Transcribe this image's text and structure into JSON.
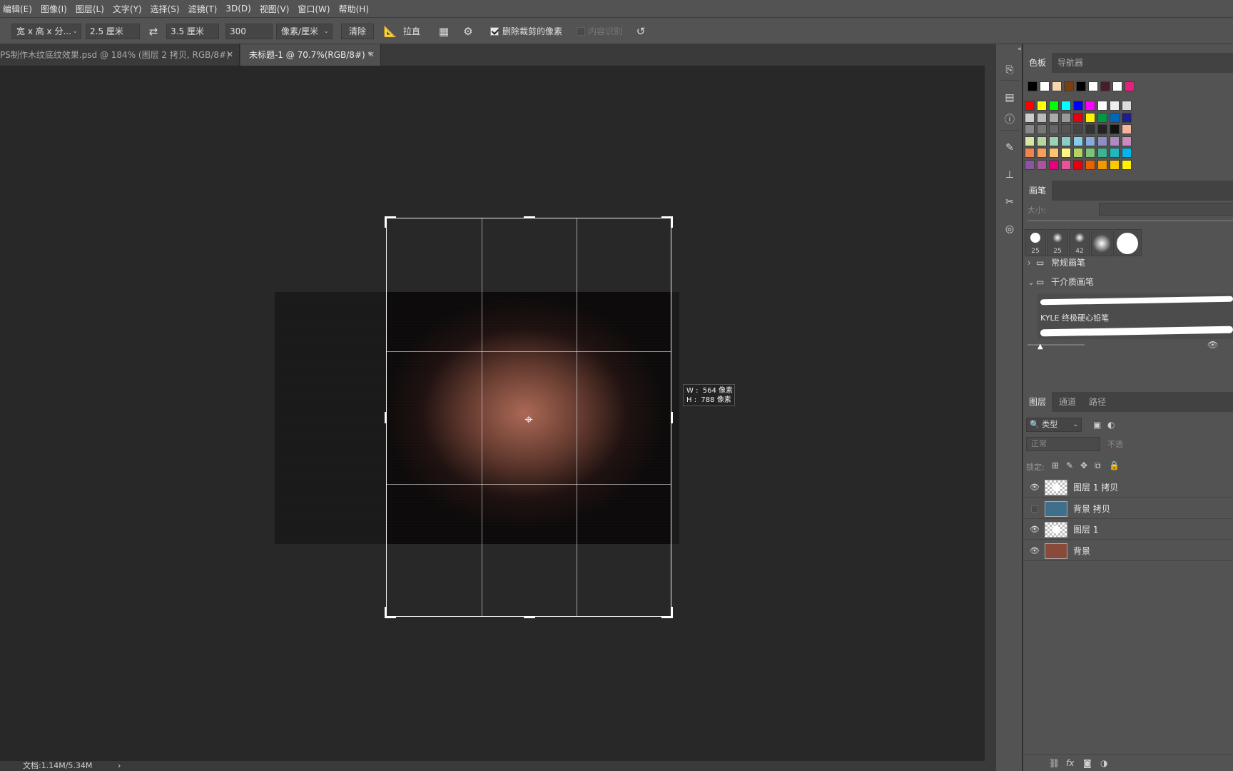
{
  "menu": [
    "编辑(E)",
    "图像(I)",
    "图层(L)",
    "文字(Y)",
    "选择(S)",
    "滤镜(T)",
    "3D(D)",
    "视图(V)",
    "窗口(W)",
    "帮助(H)"
  ],
  "options_bar": {
    "ratio_preset": "宽 x 高 x 分...",
    "width_value": "2.5 厘米",
    "height_value": "3.5 厘米",
    "resolution_value": "300",
    "resolution_unit": "像素/厘米",
    "clear_label": "清除",
    "straighten_label": "拉直",
    "delete_cropped_label": "删除裁剪的像素",
    "delete_cropped_checked": true,
    "content_aware_label": "内容识别",
    "content_aware_checked": false
  },
  "tabs": [
    {
      "label": "PS制作木纹底纹效果.psd @ 184% (图层 2 拷贝, RGB/8#)",
      "active": false
    },
    {
      "label": "未标题-1 @ 70.7%(RGB/8#) *",
      "active": true
    }
  ],
  "crop_tooltip": {
    "w_label": "W :  564 像素",
    "h_label": "H :  788 像素"
  },
  "status_bar": {
    "doc_info": "文档:1.14M/5.34M",
    "arrow": "›"
  },
  "swatches_panel": {
    "tabs": [
      "色板",
      "导航器"
    ],
    "recent_colors": [
      "#000000",
      "#ffffff",
      "#f6d6b0",
      "#7a3e14",
      "#000000",
      "#ffffff",
      "#4a1a2e",
      "#ffffff",
      "#e6207d"
    ],
    "grid_colors": [
      [
        "#ff0000",
        "#ffff00",
        "#00ff00",
        "#00ffff",
        "#0000ff",
        "#ff00ff",
        "#ffffff",
        "#eeeeee",
        "#dddddd"
      ],
      [
        "#cccccc",
        "#bbbbbb",
        "#aaaaaa",
        "#999999",
        "#e60012",
        "#fff100",
        "#009944",
        "#0068b7",
        "#1d2088"
      ],
      [
        "#888888",
        "#777777",
        "#666666",
        "#555555",
        "#444444",
        "#333333",
        "#222222",
        "#111111",
        "#f8b59b"
      ],
      [
        "#d7e6a0",
        "#b4d99a",
        "#9bd3b5",
        "#89cfc8",
        "#84ccec",
        "#89abdc",
        "#8f8dc3",
        "#ad8bc2",
        "#cb8bbf"
      ],
      [
        "#f0844a",
        "#f5a05a",
        "#fcc26d",
        "#fff57f",
        "#b3d465",
        "#7cc576",
        "#3cb492",
        "#1eb9bd",
        "#00b7ee"
      ],
      [
        "#8957a1",
        "#a8559e",
        "#e4007f",
        "#e85298",
        "#e60012",
        "#eb6100",
        "#f39800",
        "#fcc800",
        "#fff100"
      ]
    ]
  },
  "brush_panel": {
    "title": "画笔",
    "size_label": "大小:",
    "tips": [
      "25",
      "25",
      "42",
      "",
      ""
    ],
    "folders": [
      "常规画笔",
      "干介质画笔"
    ],
    "brush_name": "KYLE 终极硬心铅笔"
  },
  "layers_panel": {
    "tabs": [
      "图层",
      "通道",
      "路径"
    ],
    "filter_label": "类型",
    "blend_mode": "正常",
    "opacity_label": "不透",
    "lock_label": "锁定:",
    "layers": [
      {
        "name": "图层 1 拷贝",
        "visible": true,
        "thumb": "checker"
      },
      {
        "name": "背景 拷贝",
        "visible": false,
        "thumb": "#3e6f8c"
      },
      {
        "name": "图层 1",
        "visible": true,
        "thumb": "checker"
      },
      {
        "name": "背景",
        "visible": true,
        "thumb": "#8a4a3a"
      }
    ],
    "footer_icons": [
      "link-icon",
      "fx-icon",
      "mask-icon",
      "adjustment-icon"
    ]
  }
}
